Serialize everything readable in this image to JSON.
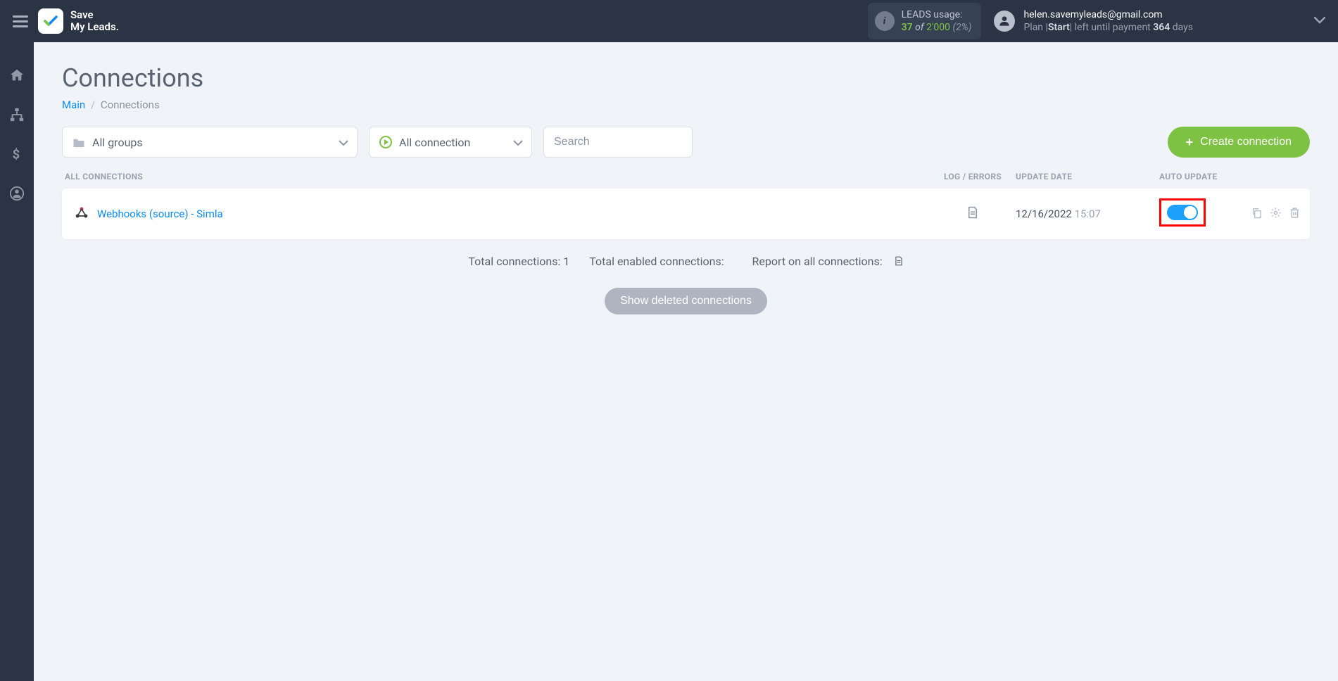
{
  "brand": {
    "line1": "Save",
    "line2": "My Leads."
  },
  "usage": {
    "label": "LEADS usage:",
    "used": "37",
    "of_word": "of",
    "total": "2'000",
    "pct": "(2%)"
  },
  "account": {
    "email": "helen.savemyleads@gmail.com",
    "plan_prefix": "Plan |",
    "plan_name": "Start",
    "plan_mid": "| left until payment",
    "days": "364",
    "days_word": "days"
  },
  "page": {
    "title": "Connections",
    "breadcrumb_main": "Main",
    "breadcrumb_current": "Connections"
  },
  "filters": {
    "groups": "All groups",
    "connection": "All connection",
    "search_placeholder": "Search"
  },
  "buttons": {
    "create": "Create connection",
    "show_deleted": "Show deleted connections"
  },
  "columns": {
    "name": "ALL CONNECTIONS",
    "log": "LOG / ERRORS",
    "date": "UPDATE DATE",
    "auto": "AUTO UPDATE"
  },
  "rows": [
    {
      "name": "Webhooks (source) - Simla",
      "date": "12/16/2022",
      "time": "15:07"
    }
  ],
  "summary": {
    "total": "Total connections: 1",
    "enabled": "Total enabled connections:",
    "report": "Report on all connections:"
  }
}
